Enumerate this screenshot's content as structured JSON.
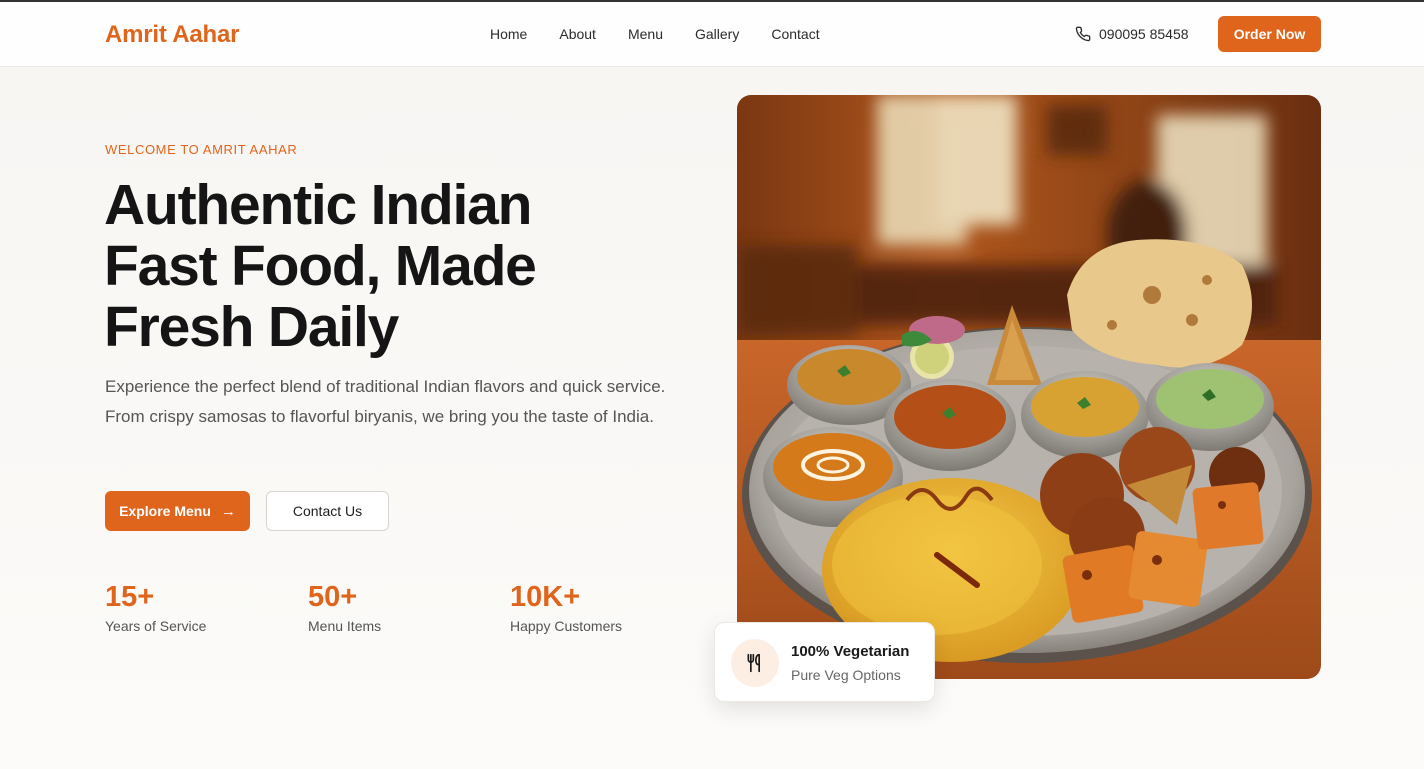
{
  "header": {
    "brand": "Amrit Aahar",
    "nav": [
      "Home",
      "About",
      "Menu",
      "Gallery",
      "Contact"
    ],
    "phone": "090095 85458",
    "cta": "Order Now"
  },
  "hero": {
    "eyebrow": "WELCOME TO AMRIT AAHAR",
    "title_lines": [
      "Authentic Indian",
      "Fast Food, Made",
      "Fresh Daily"
    ],
    "description": "Experience the perfect blend of traditional Indian flavors and quick service. From crispy samosas to flavorful biryanis, we bring you the taste of India.",
    "primary_button": "Explore Menu",
    "secondary_button": "Contact Us",
    "stats": [
      {
        "value": "15+",
        "label": "Years of Service"
      },
      {
        "value": "50+",
        "label": "Menu Items"
      },
      {
        "value": "10K+",
        "label": "Happy Customers"
      }
    ],
    "badge": {
      "title": "100% Vegetarian",
      "subtitle": "Pure Veg Options",
      "icon": "utensils-icon"
    }
  },
  "colors": {
    "accent": "#e0651c",
    "text": "#151515",
    "muted": "#555555"
  }
}
